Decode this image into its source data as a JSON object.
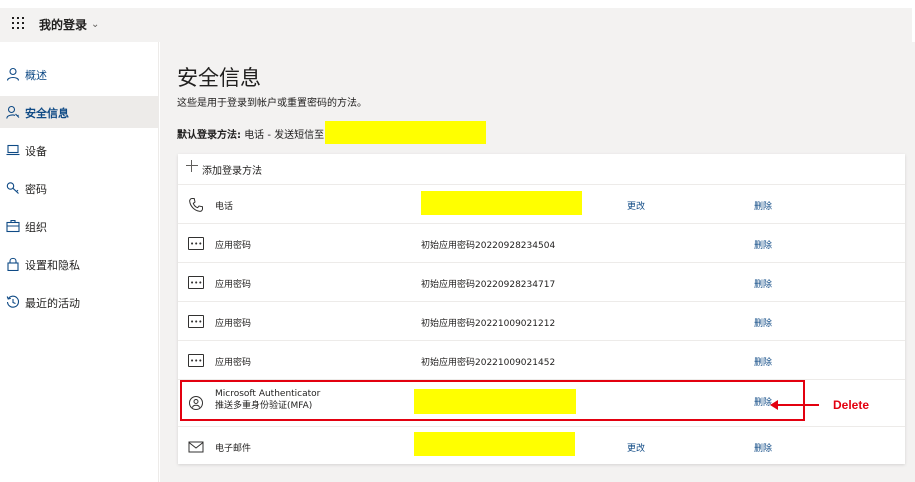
{
  "header": {
    "app_title": "我的登录"
  },
  "sidebar": {
    "items": [
      {
        "label": "概述",
        "icon": "person-icon"
      },
      {
        "label": "安全信息",
        "icon": "person-key-icon",
        "active": true
      },
      {
        "label": "设备",
        "icon": "laptop-icon"
      },
      {
        "label": "密码",
        "icon": "key-icon"
      },
      {
        "label": "组织",
        "icon": "briefcase-icon"
      },
      {
        "label": "设置和隐私",
        "icon": "lock-icon"
      },
      {
        "label": "最近的活动",
        "icon": "history-icon"
      }
    ]
  },
  "main": {
    "title": "安全信息",
    "subtitle": "这些是用于登录到帐户或重置密码的方法。",
    "default_label": "默认登录方法:",
    "default_value": "电话 - 发送短信至",
    "add_method": "添加登录方法",
    "methods": [
      {
        "icon": "phone-icon",
        "name": "电话",
        "detail": "",
        "change": "更改",
        "delete": "删除"
      },
      {
        "icon": "app-password-icon",
        "name": "应用密码",
        "detail": "初始应用密码20220928234504",
        "change": "",
        "delete": "删除"
      },
      {
        "icon": "app-password-icon",
        "name": "应用密码",
        "detail": "初始应用密码20220928234717",
        "change": "",
        "delete": "删除"
      },
      {
        "icon": "app-password-icon",
        "name": "应用密码",
        "detail": "初始应用密码20221009021212",
        "change": "",
        "delete": "删除"
      },
      {
        "icon": "app-password-icon",
        "name": "应用密码",
        "detail": "初始应用密码20221009021452",
        "change": "",
        "delete": "删除"
      },
      {
        "icon": "authenticator-icon",
        "name": "Microsoft Authenticator",
        "name2": "推送多重身份验证(MFA)",
        "detail": "",
        "change": "",
        "delete": "删除"
      },
      {
        "icon": "mail-icon",
        "name": "电子邮件",
        "detail": "",
        "change": "更改",
        "delete": "删除"
      }
    ]
  },
  "annotation": {
    "label": "Delete",
    "color": "#e3000f"
  },
  "colors": {
    "accent": "#0f4a85",
    "redaction": "#ffff00"
  }
}
